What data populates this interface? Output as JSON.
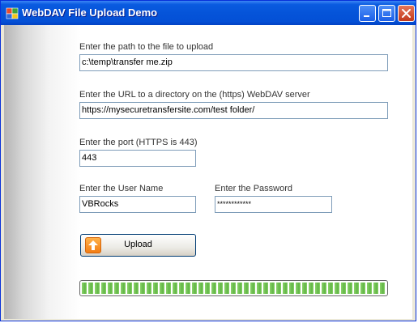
{
  "window": {
    "title": "WebDAV File Upload Demo"
  },
  "form": {
    "file_path_label": "Enter the path to the file to upload",
    "file_path_value": "c:\\temp\\transfer me.zip",
    "url_label": "Enter the URL to a directory on the (https) WebDAV server",
    "url_value": "https://mysecuretransfersite.com/test folder/",
    "port_label": "Enter the port (HTTPS is 443)",
    "port_value": "443",
    "username_label": "Enter the User Name",
    "username_value": "VBRocks",
    "password_label": "Enter the Password",
    "password_value": "************",
    "upload_button_label": "Upload"
  },
  "progress": {
    "value_percent": 100
  },
  "colors": {
    "title_bar": "#0554d9",
    "progress_fill": "#61b545",
    "upload_icon": "#f37d14"
  },
  "icons": [
    "app-icon",
    "minimize-icon",
    "maximize-icon",
    "close-icon",
    "upload-arrow-icon"
  ]
}
